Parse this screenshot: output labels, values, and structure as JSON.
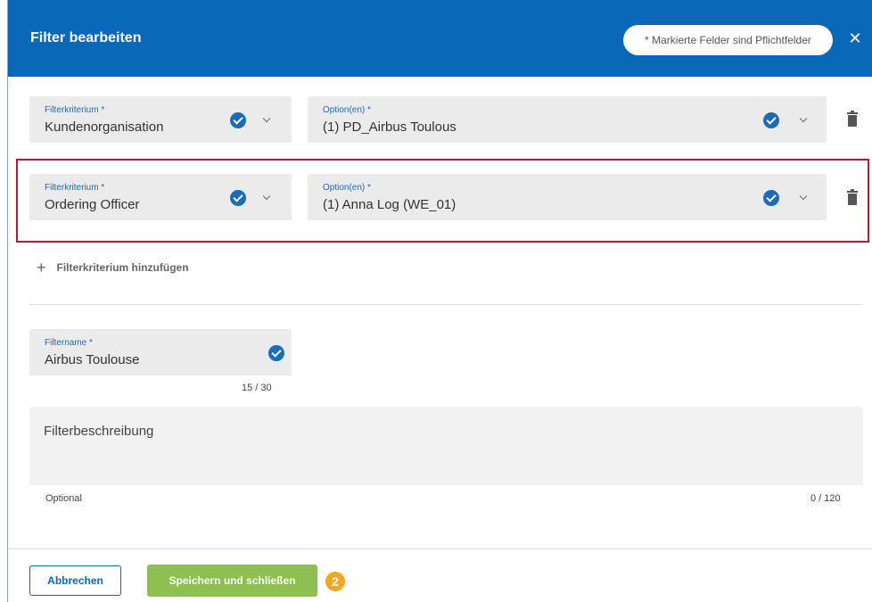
{
  "header": {
    "title": "Filter bearbeiten",
    "required_note": "* Markierte Felder sind Pflichtfelder",
    "close_icon": "close-icon"
  },
  "filters": [
    {
      "criterion_label": "Filterkriterium *",
      "criterion_value": "Kundenorganisation",
      "options_label": "Option(en) *",
      "options_value": "(1) PD_Airbus Toulous"
    },
    {
      "criterion_label": "Filterkriterium *",
      "criterion_value": "Ordering Officer",
      "options_label": "Option(en) *",
      "options_value": "(1) Anna Log (WE_01)"
    }
  ],
  "add_criterion": {
    "icon": "plus-icon",
    "label": "Filterkriterium hinzufügen"
  },
  "filter_name": {
    "label": "Filtername *",
    "value": "Airbus Toulouse",
    "counter": "15 / 30"
  },
  "description": {
    "placeholder": "Filterbeschreibung",
    "hint": "Optional",
    "counter": "0 / 120"
  },
  "footer": {
    "cancel_label": "Abbrechen",
    "save_label": "Speichern und schließen",
    "step_badge": "2"
  },
  "colors": {
    "header": "#0b68b8",
    "accent": "#1a6bb8",
    "save": "#8cc152",
    "highlight": "#b01e2a",
    "badge": "#f5a623"
  }
}
